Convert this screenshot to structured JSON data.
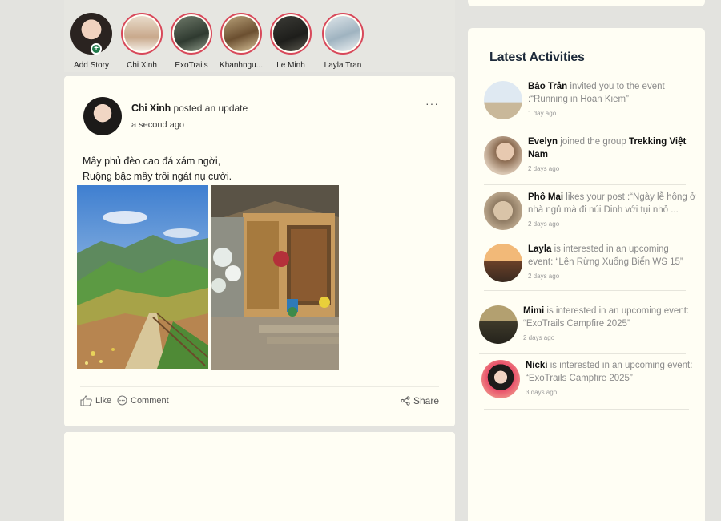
{
  "stories": [
    {
      "label": "Add Story",
      "add_badge": "+"
    },
    {
      "label": "Chi Xinh"
    },
    {
      "label": "ExoTrails"
    },
    {
      "label": "Khanhngu..."
    },
    {
      "label": "Le Minh"
    },
    {
      "label": "Layla Tran"
    }
  ],
  "post": {
    "author": "Chi Xinh",
    "action": "posted an update",
    "time": "a second ago",
    "more": "···",
    "text_line1": "Mây phủ đèo cao đá xám ngời,",
    "text_line2": "Ruộng bậc mây trôi ngát nụ cười.",
    "like_label": "Like",
    "comment_label": "Comment",
    "share_label": "Share"
  },
  "activities": {
    "title": "Latest Activities",
    "items": [
      {
        "name": "Bảo Trân",
        "text": " invited you to the event :“Running in Hoan Kiem”",
        "time": "1 day ago"
      },
      {
        "name": "Evelyn",
        "text": " joined the group ",
        "group": "Trekking Việt Nam",
        "time": "2 days ago"
      },
      {
        "name": "Phô Mai",
        "text": " likes your post :“Ngày lễ hông ở nhà ngủ mà đi núi Dinh với tụi nhỏ ...",
        "time": "2 days ago"
      },
      {
        "name": "Layla",
        "text": "  is interested in an upcoming event: “Lên Rừng Xuống Biển WS 15”",
        "time": "2 days ago"
      },
      {
        "name": "Mimi",
        "text": " is interested in an upcoming event: “ExoTrails Campfire 2025”",
        "time": "2 days ago"
      },
      {
        "name": "Nicki",
        "text": "  is interested in an upcoming event: “ExoTrails Campfire 2025”",
        "time": "3 days ago"
      }
    ]
  },
  "colors": {
    "page_bg": "#e3e3df",
    "card_bg": "#fffef4",
    "story_ring": "#d8485a",
    "add_badge": "#1f7a4a",
    "title_text": "#1d2a3a"
  }
}
